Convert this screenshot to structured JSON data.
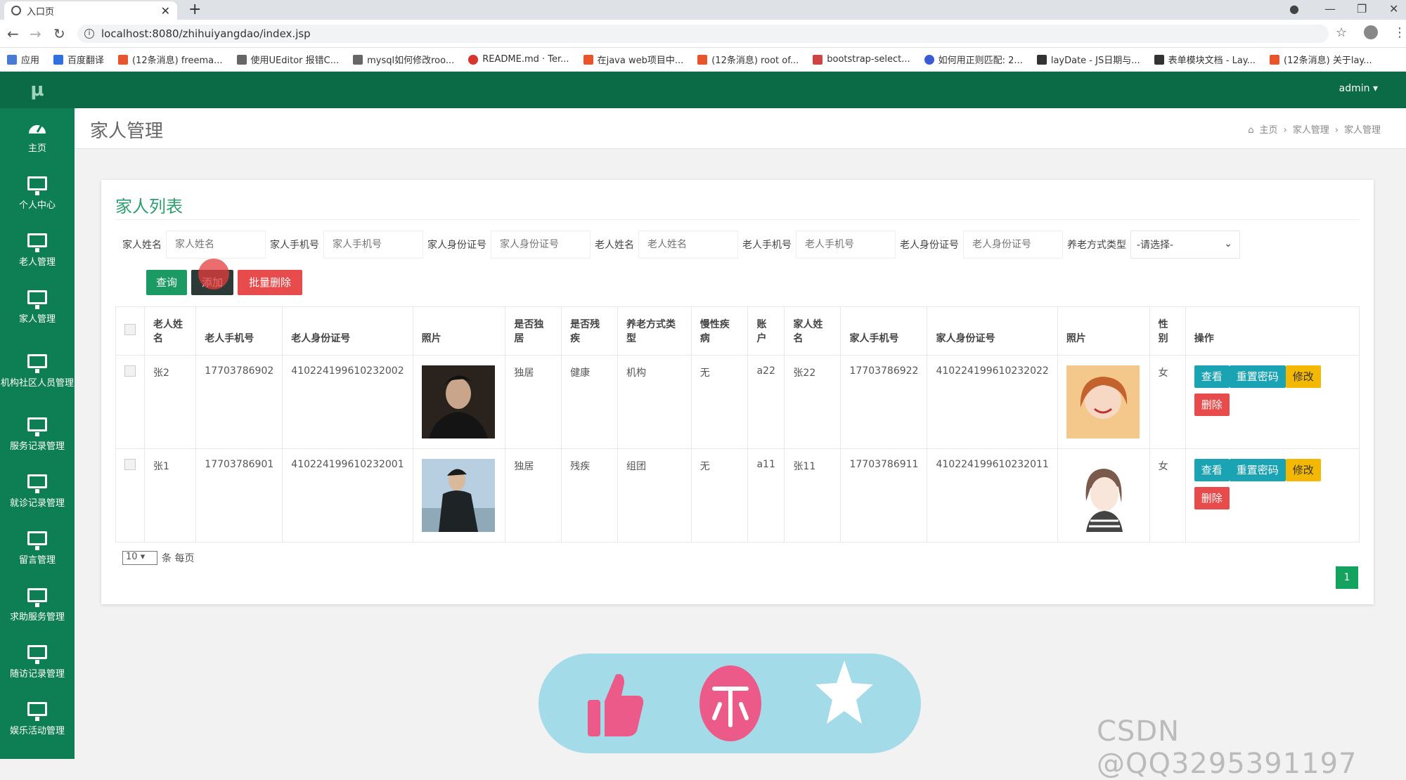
{
  "browser": {
    "tab_title": "入口页",
    "url": "localhost:8080/zhihuiyangdao/index.jsp",
    "bookmarks": [
      "应用",
      "百度翻译",
      "(12条消息) freema...",
      "使用UEditor 报错C...",
      "mysql如何修改roo...",
      "README.md · Ter...",
      "在java web项目中...",
      "(12条消息) root of...",
      "bootstrap-select...",
      "如何用正则匹配: 2...",
      "layDate - JS日期与...",
      "表单模块文档 - Lay...",
      "(12条消息) 关于lay..."
    ]
  },
  "header": {
    "user": "admin"
  },
  "sidebar": {
    "logo": "μ",
    "items": [
      "主页",
      "个人中心",
      "老人管理",
      "家人管理",
      "机构社区人员管理",
      "服务记录管理",
      "就诊记录管理",
      "留言管理",
      "求助服务管理",
      "随访记录管理",
      "娱乐活动管理"
    ]
  },
  "page": {
    "title": "家人管理",
    "breadcrumb": [
      "主页",
      "家人管理",
      "家人管理"
    ]
  },
  "panel": {
    "title": "家人列表"
  },
  "filters": [
    {
      "label": "家人姓名",
      "placeholder": "家人姓名"
    },
    {
      "label": "家人手机号",
      "placeholder": "家人手机号"
    },
    {
      "label": "家人身份证号",
      "placeholder": "家人身份证号"
    },
    {
      "label": "老人姓名",
      "placeholder": "老人姓名"
    },
    {
      "label": "老人手机号",
      "placeholder": "老人手机号"
    },
    {
      "label": "老人身份证号",
      "placeholder": "老人身份证号"
    }
  ],
  "filter_select": {
    "label": "养老方式类型",
    "value": "-请选择-"
  },
  "buttons": {
    "query": "查询",
    "add": "添加",
    "batch_delete": "批量删除"
  },
  "table": {
    "headers": [
      "老人姓名",
      "老人手机号",
      "老人身份证号",
      "照片",
      "是否独居",
      "是否残疾",
      "养老方式类型",
      "慢性疾病",
      "账户",
      "家人姓名",
      "家人手机号",
      "家人身份证号",
      "照片",
      "性别",
      "操作"
    ],
    "rows": [
      {
        "elder_name": "张2",
        "elder_phone": "17703786902",
        "elder_id": "410224199610232002",
        "living_alone": "独居",
        "disabled": "健康",
        "care_type": "机构",
        "chronic": "无",
        "account": "a22",
        "family_name": "张22",
        "family_phone": "17703786922",
        "family_id": "410224199610232022",
        "gender": "女"
      },
      {
        "elder_name": "张1",
        "elder_phone": "17703786901",
        "elder_id": "410224199610232001",
        "living_alone": "独居",
        "disabled": "残疾",
        "care_type": "组团",
        "chronic": "无",
        "account": "a11",
        "family_name": "张11",
        "family_phone": "17703786911",
        "family_id": "410224199610232011",
        "gender": "女"
      }
    ],
    "ops": {
      "view": "查看",
      "reset": "重置密码",
      "edit": "修改",
      "delete": "删除"
    }
  },
  "pagination": {
    "per_page": "10",
    "per_page_suffix": "条 每页",
    "page": "1"
  },
  "watermark": "CSDN @QQ3295391197",
  "colors": {
    "sidebar": "#0e7f54",
    "topnav": "#0b6b47",
    "teal": "#1aa3b3",
    "yellow": "#f5b800",
    "red": "#e84b4b",
    "green_btn": "#1b9a64"
  }
}
